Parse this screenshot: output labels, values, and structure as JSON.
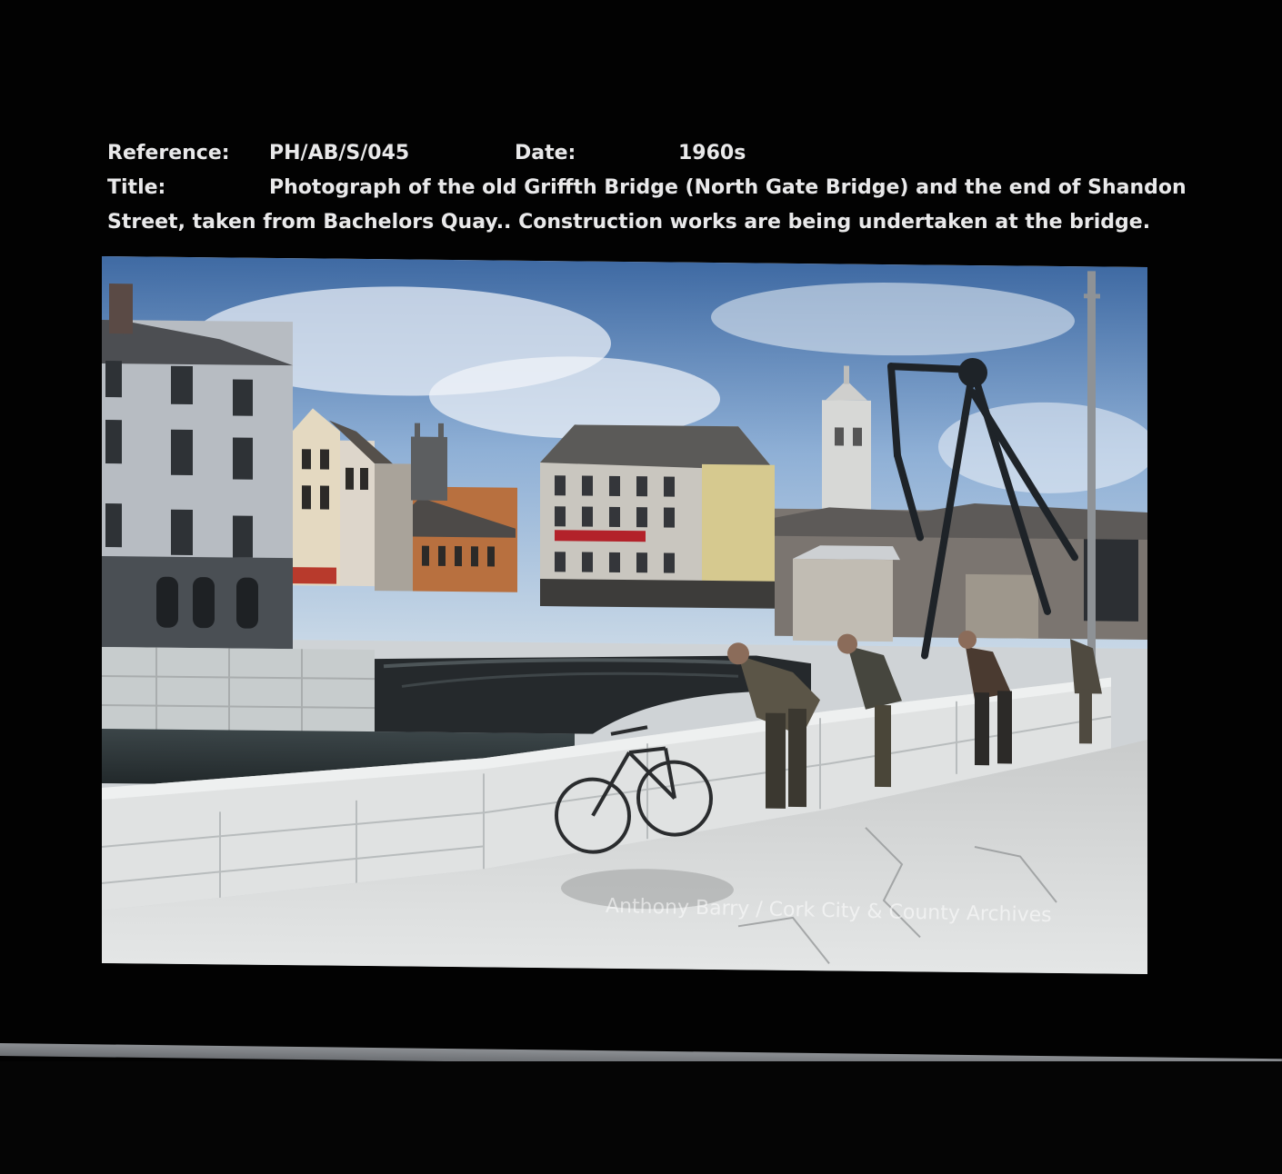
{
  "record": {
    "reference_label": "Reference:",
    "reference_value": "PH/AB/S/045",
    "date_label": "Date:",
    "date_value": "1960s",
    "title_label": "Title:",
    "title_line1": "Photograph of the old Griffth Bridge (North Gate Bridge) and the end of Shandon",
    "title_line2": "Street, taken from Bachelors Quay.. Construction works are being undertaken at the bridge."
  },
  "photo": {
    "watermark": "Anthony Barry / Cork City & County Archives"
  },
  "colors": {
    "background": "#020202",
    "text": "#e9e9ea",
    "sky": "#6f94c4",
    "stone": "#d9dcdc"
  }
}
